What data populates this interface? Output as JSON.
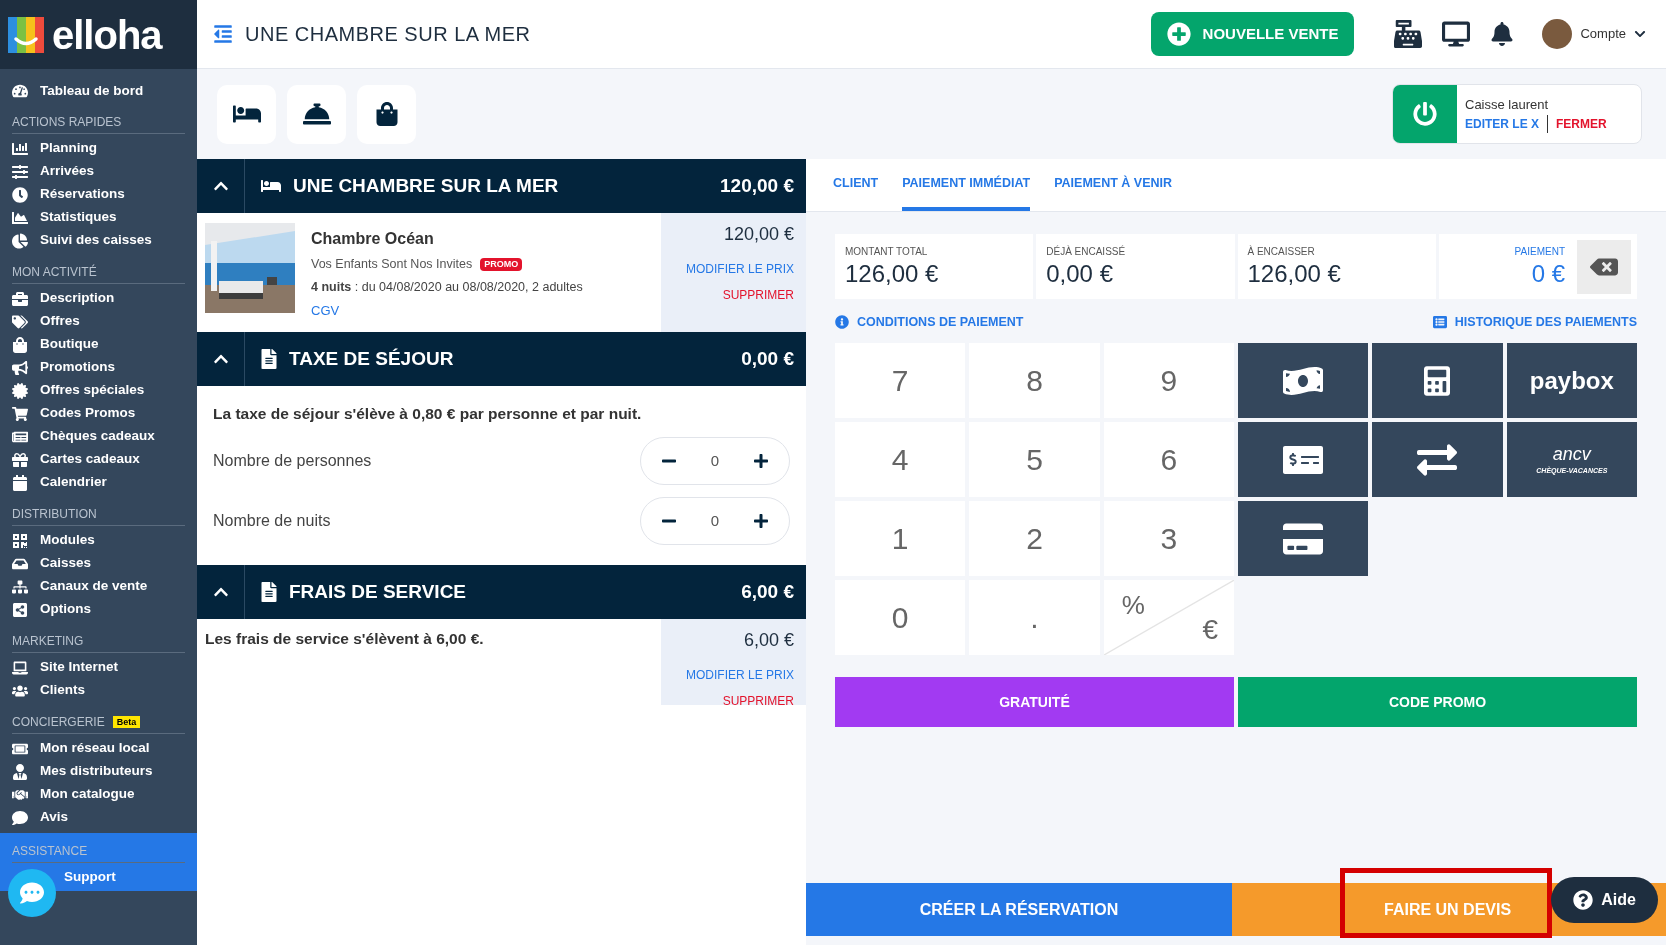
{
  "logo": {
    "text": "elloha"
  },
  "sidebar": {
    "top_item": {
      "label": "Tableau de bord"
    },
    "sections": [
      {
        "title": "ACTIONS RAPIDES",
        "highlighted": false,
        "items": [
          {
            "label": "Planning"
          },
          {
            "label": "Arrivées"
          },
          {
            "label": "Réservations"
          },
          {
            "label": "Statistiques"
          },
          {
            "label": "Suivi des caisses"
          }
        ]
      },
      {
        "title": "MON ACTIVITÉ",
        "highlighted": false,
        "items": [
          {
            "label": "Description"
          },
          {
            "label": "Offres"
          },
          {
            "label": "Boutique"
          },
          {
            "label": "Promotions"
          },
          {
            "label": "Offres spéciales"
          },
          {
            "label": "Codes Promos"
          },
          {
            "label": "Chèques cadeaux"
          },
          {
            "label": "Cartes cadeaux"
          },
          {
            "label": "Calendrier"
          }
        ]
      },
      {
        "title": "DISTRIBUTION",
        "highlighted": false,
        "items": [
          {
            "label": "Modules"
          },
          {
            "label": "Caisses"
          },
          {
            "label": "Canaux de vente"
          },
          {
            "label": "Options"
          }
        ]
      },
      {
        "title": "MARKETING",
        "highlighted": false,
        "items": [
          {
            "label": "Site Internet"
          },
          {
            "label": "Clients"
          }
        ]
      },
      {
        "title": "CONCIERGERIE",
        "badge": "Beta",
        "highlighted": false,
        "items": [
          {
            "label": "Mon réseau local"
          },
          {
            "label": "Mes distributeurs"
          },
          {
            "label": "Mon catalogue"
          },
          {
            "label": "Avis"
          }
        ]
      },
      {
        "title": "ASSISTANCE",
        "highlighted": true,
        "items": [
          {
            "label": "Support"
          }
        ]
      }
    ]
  },
  "header": {
    "title": "UNE CHAMBRE SUR LA MER",
    "new_sale_button": "NOUVELLE VENTE",
    "account": "Compte"
  },
  "register": {
    "name": "Caisse laurent",
    "edit_link": "EDITER LE X",
    "close_link": "FERMER"
  },
  "cart": [
    {
      "kind": "product",
      "title": "UNE CHAMBRE SUR LA MER",
      "total": "120,00 €",
      "expanded": true,
      "name": "Chambre Océan",
      "offer": "Vos Enfants Sont Nos Invites",
      "badge": "PROMO",
      "details": "**4 nuits** : du 04/08/2020 au 08/08/2020, 2 adultes",
      "link": "CGV",
      "price": "120,00 €",
      "edit": "MODIFIER LE PRIX",
      "delete": "SUPPRIMER"
    },
    {
      "kind": "tax",
      "title": "TAXE DE SÉJOUR",
      "total": "0,00 €",
      "expanded": true,
      "note": "La taxe de séjour s'élève à 0,80 € par personne et par nuit.",
      "counters": [
        {
          "label": "Nombre de personnes",
          "value": "0"
        },
        {
          "label": "Nombre de nuits",
          "value": "0"
        }
      ]
    },
    {
      "kind": "fee",
      "title": "FRAIS DE SERVICE",
      "total": "6,00 €",
      "expanded": true,
      "note": "Les frais de service s'élèvent à 6,00 €.",
      "price": "6,00 €",
      "edit": "MODIFIER LE PRIX",
      "delete": "SUPPRIMER"
    }
  ],
  "payment": {
    "tabs": [
      {
        "label": "CLIENT",
        "selected": false
      },
      {
        "label": "PAIEMENT IMMÉDIAT",
        "selected": true
      },
      {
        "label": "PAIEMENT À VENIR",
        "selected": false
      }
    ],
    "summary": [
      {
        "kind": "amount",
        "label": "MONTANT TOTAL",
        "value": "126,00 €"
      },
      {
        "kind": "amount",
        "label": "DÉJÀ ENCAISSÉ",
        "value": "0,00 €"
      },
      {
        "kind": "amount",
        "label": "À ENCAISSER",
        "value": "126,00 €"
      },
      {
        "kind": "input",
        "label": "PAIEMENT",
        "value": "0 €"
      }
    ],
    "conditions_link": "CONDITIONS DE PAIEMENT",
    "history_link": "HISTORIQUE DES PAIEMENTS",
    "keys": [
      "7",
      "8",
      "9",
      "4",
      "5",
      "6",
      "1",
      "2",
      "3",
      "0",
      "."
    ],
    "toggle": {
      "percent": "%",
      "euro": "€"
    },
    "methods": [
      {
        "kind": "cash"
      },
      {
        "kind": "terminal"
      },
      {
        "kind": "paybox",
        "text": "paybox"
      },
      {
        "kind": "cheque"
      },
      {
        "kind": "transfer"
      },
      {
        "kind": "ancv",
        "text": "ancv",
        "subtext": "CHÈQUE-VACANCES"
      },
      {
        "kind": "giftcard"
      }
    ],
    "free_button": "GRATUITÉ",
    "promo_button": "CODE PROMO"
  },
  "footer": {
    "create_button": "CRÉER LA RÉSERVATION",
    "quote_button": "FAIRE UN DEVIS",
    "quote_highlighted": true,
    "help_button": "Aide"
  }
}
